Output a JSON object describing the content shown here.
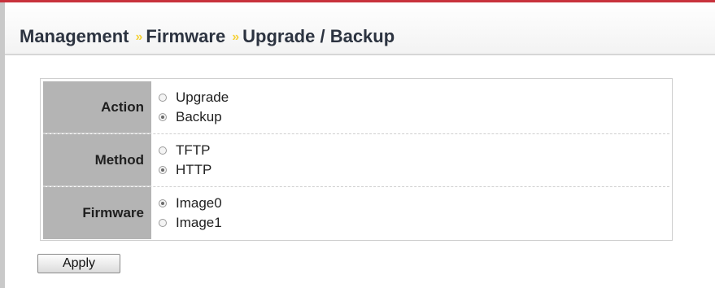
{
  "breadcrumb": {
    "items": [
      "Management",
      "Firmware",
      "Upgrade / Backup"
    ],
    "separator": "»"
  },
  "form": {
    "rows": [
      {
        "label": "Action",
        "options": [
          {
            "label": "Upgrade",
            "checked": false
          },
          {
            "label": "Backup",
            "checked": true
          }
        ]
      },
      {
        "label": "Method",
        "options": [
          {
            "label": "TFTP",
            "checked": false
          },
          {
            "label": "HTTP",
            "checked": true
          }
        ]
      },
      {
        "label": "Firmware",
        "options": [
          {
            "label": "Image0",
            "checked": true
          },
          {
            "label": "Image1",
            "checked": false
          }
        ]
      }
    ]
  },
  "apply_label": "Apply",
  "colors": {
    "accent_line": "#c8323c",
    "separator": "#f5d23a",
    "label_bg": "#b4b4b4"
  }
}
